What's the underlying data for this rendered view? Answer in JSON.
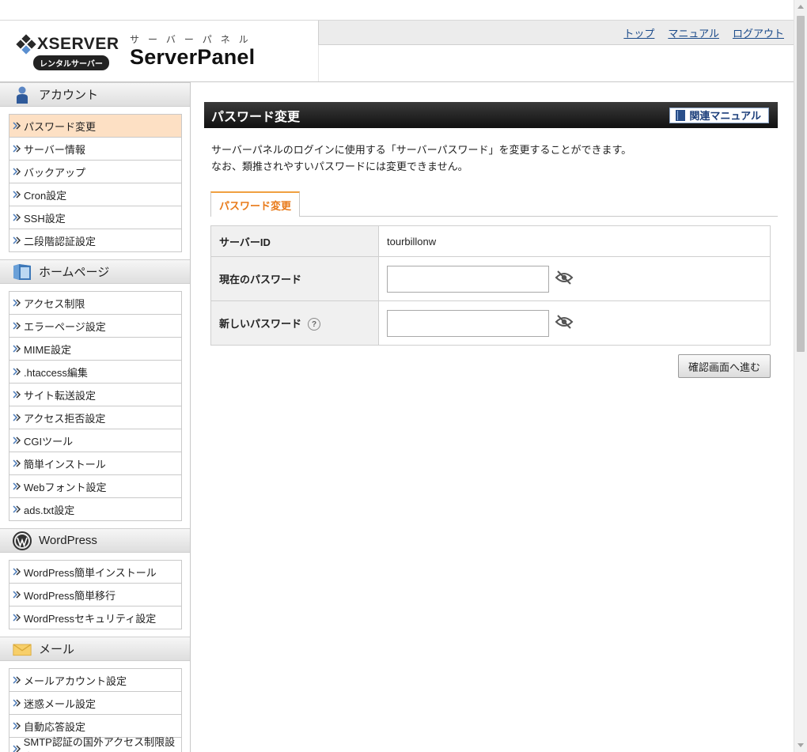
{
  "header": {
    "brand": "XSERVER",
    "brand_sub": "レンタルサーバー",
    "panel_kana": "サーバーパネル",
    "panel_name": "ServerPanel",
    "links": {
      "top": "トップ",
      "manual": "マニュアル",
      "logout": "ログアウト"
    }
  },
  "sidebar": {
    "account": {
      "title": "アカウント",
      "items": [
        "パスワード変更",
        "サーバー情報",
        "バックアップ",
        "Cron設定",
        "SSH設定",
        "二段階認証設定"
      ]
    },
    "homepage": {
      "title": "ホームページ",
      "items": [
        "アクセス制限",
        "エラーページ設定",
        "MIME設定",
        ".htaccess編集",
        "サイト転送設定",
        "アクセス拒否設定",
        "CGIツール",
        "簡単インストール",
        "Webフォント設定",
        "ads.txt設定"
      ]
    },
    "wordpress": {
      "title": "WordPress",
      "items": [
        "WordPress簡単インストール",
        "WordPress簡単移行",
        "WordPressセキュリティ設定"
      ]
    },
    "mail": {
      "title": "メール",
      "items": [
        "メールアカウント設定",
        "迷惑メール設定",
        "自動応答設定",
        "SMTP認証の国外アクセス制限設定"
      ]
    }
  },
  "main": {
    "title": "パスワード変更",
    "manual_button": "関連マニュアル",
    "desc_line1": "サーバーパネルのログインに使用する「サーバーパスワード」を変更することができます。",
    "desc_line2": "なお、類推されやすいパスワードには変更できません。",
    "tab": "パスワード変更",
    "form": {
      "server_id_label": "サーバーID",
      "server_id_value": "tourbillonw",
      "current_password_label": "現在のパスワード",
      "current_password_value": "",
      "new_password_label": "新しいパスワード",
      "new_password_value": "",
      "help_mark": "?"
    },
    "confirm_button": "確認画面へ進む"
  },
  "colors": {
    "active_item": "#fde0c4",
    "tab_accent": "#e87a1a",
    "title_bar": "#1a1a1a",
    "link": "#1a4a8a"
  }
}
